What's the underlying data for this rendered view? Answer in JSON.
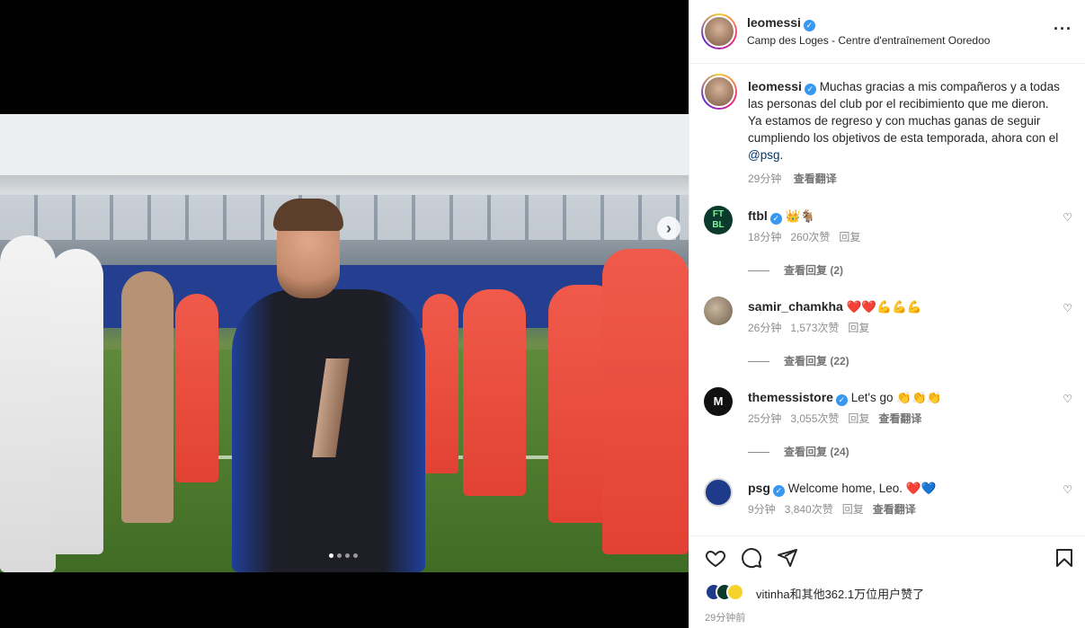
{
  "post": {
    "username": "leomessi",
    "location": "Camp des Loges - Centre d'entraînement Ooredoo",
    "more_icon": "more-horizontal-icon",
    "caption": {
      "text": "Muchas gracias a mis compañeros y a todas las personas del club por el recibimiento que me dieron. Ya estamos de regreso y con muchas ganas de seguir cumpliendo los objetivos de esta temporada, ahora con el",
      "mention": "@psg",
      "end": ".",
      "time": "29分钟",
      "translate": "查看翻译"
    },
    "carousel": {
      "dots": 4,
      "active": 1
    }
  },
  "comments": [
    {
      "username": "ftbl",
      "text": "👑🐐",
      "time": "18分钟",
      "likes": "260次赞",
      "reply": "回复",
      "translate": "",
      "view_replies": "查看回复 (2)"
    },
    {
      "username": "samir_chamkha",
      "text": "❤️❤️💪💪💪",
      "time": "26分钟",
      "likes": "1,573次赞",
      "reply": "回复",
      "translate": "",
      "view_replies": "查看回复 (22)"
    },
    {
      "username": "themessistore",
      "text": "Let's go 👏👏👏",
      "time": "25分钟",
      "likes": "3,055次赞",
      "reply": "回复",
      "translate": "查看翻译",
      "view_replies": "查看回复 (24)"
    },
    {
      "username": "psg",
      "text": "Welcome home, Leo. ❤️💙",
      "time": "9分钟",
      "likes": "3,840次赞",
      "reply": "回复",
      "translate": "查看翻译",
      "view_replies": ""
    }
  ],
  "footer": {
    "liked_by": "vitinha和其他362.1万位用户赞了",
    "time": "29分钟前"
  },
  "colors": {
    "verified": "#3897f0",
    "mention": "#00376b",
    "psg_blue": "#1e3b8a"
  }
}
